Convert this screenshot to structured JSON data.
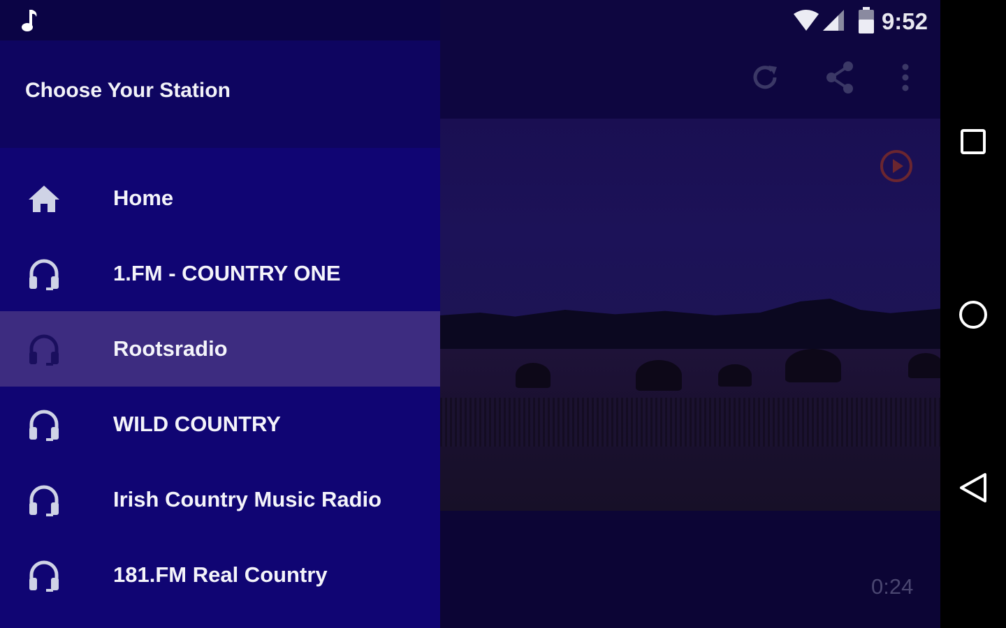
{
  "status_bar": {
    "time": "9:52",
    "notification_icon": "music-note-icon",
    "wifi_icon": "wifi-icon",
    "signal_icon": "cell-signal-icon",
    "battery_icon": "battery-icon"
  },
  "drawer": {
    "title": "Choose Your Station",
    "items": [
      {
        "label": "Home",
        "icon": "home-icon",
        "selected": false
      },
      {
        "label": "1.FM - COUNTRY ONE",
        "icon": "headphones-icon",
        "selected": false
      },
      {
        "label": "Rootsradio",
        "icon": "headphones-icon",
        "selected": true
      },
      {
        "label": "WILD COUNTRY",
        "icon": "headphones-icon",
        "selected": false
      },
      {
        "label": "Irish Country Music Radio",
        "icon": "headphones-icon",
        "selected": false
      },
      {
        "label": "181.FM Real Country",
        "icon": "headphones-icon",
        "selected": false
      }
    ]
  },
  "toolbar": {
    "actions": [
      "refresh-icon",
      "share-icon",
      "more-vert-icon"
    ]
  },
  "player": {
    "elapsed": "0:24",
    "play_icon": "play-circle-icon"
  },
  "system_nav": [
    "recents-icon",
    "home-circle-icon",
    "back-icon"
  ],
  "colors": {
    "drawer_bg": "#100573",
    "drawer_selected": "#3d2c80",
    "play_accent": "#7a2a2a"
  }
}
